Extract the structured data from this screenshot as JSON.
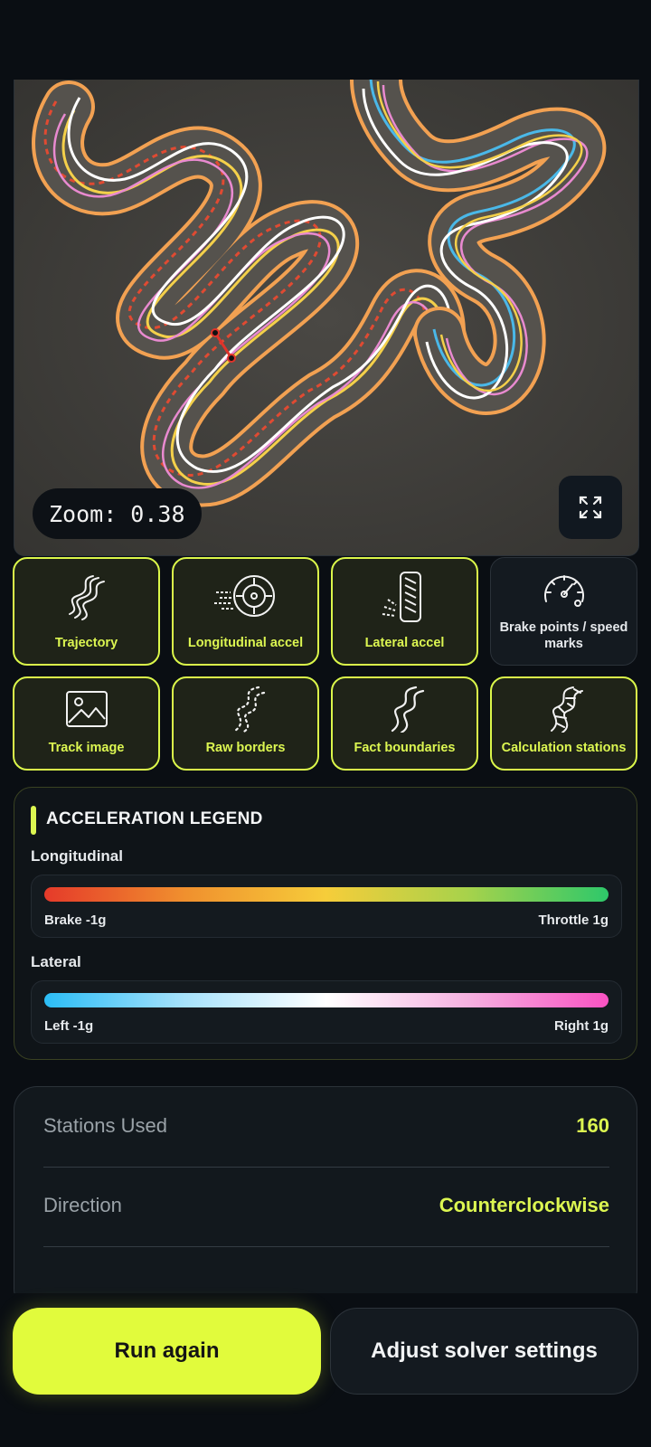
{
  "map": {
    "zoom_text": "Zoom: 0.38",
    "expand_icon": "expand-icon",
    "image": "aerial-view-track-with-racing-lines"
  },
  "layers": [
    {
      "label": "Trajectory",
      "icon": "trajectory-icon",
      "active": true
    },
    {
      "label": "Longitudinal accel",
      "icon": "wheel-speed-icon",
      "active": true
    },
    {
      "label": "Lateral accel",
      "icon": "tire-icon",
      "active": true
    },
    {
      "label": "Brake points / speed marks",
      "icon": "speedometer-icon",
      "active": false
    },
    {
      "label": "Track image",
      "icon": "image-icon",
      "active": true
    },
    {
      "label": "Raw borders",
      "icon": "dotted-path-icon",
      "active": true
    },
    {
      "label": "Fact boundaries",
      "icon": "curve-path-icon",
      "active": true
    },
    {
      "label": "Calculation stations",
      "icon": "ladder-path-icon",
      "active": true
    }
  ],
  "legend": {
    "title": "ACCELERATION LEGEND",
    "longitudinal": {
      "label": "Longitudinal",
      "min": "Brake -1g",
      "max": "Throttle 1g",
      "colors": [
        "#e53a2a",
        "#f0902e",
        "#f6cd3a",
        "#a7d24b",
        "#2ec86a"
      ]
    },
    "lateral": {
      "label": "Lateral",
      "min": "Left -1g",
      "max": "Right 1g",
      "colors": [
        "#2bbdf6",
        "#a7e2fb",
        "#ffffff",
        "#f5b1e0",
        "#f952c2"
      ]
    }
  },
  "stats": [
    {
      "key": "Stations Used",
      "value": "160"
    },
    {
      "key": "Direction",
      "value": "Counterclockwise"
    }
  ],
  "actions": {
    "primary": "Run again",
    "secondary": "Adjust solver settings"
  },
  "colors": {
    "accent": "#dcf651",
    "background": "#0a0e13"
  }
}
